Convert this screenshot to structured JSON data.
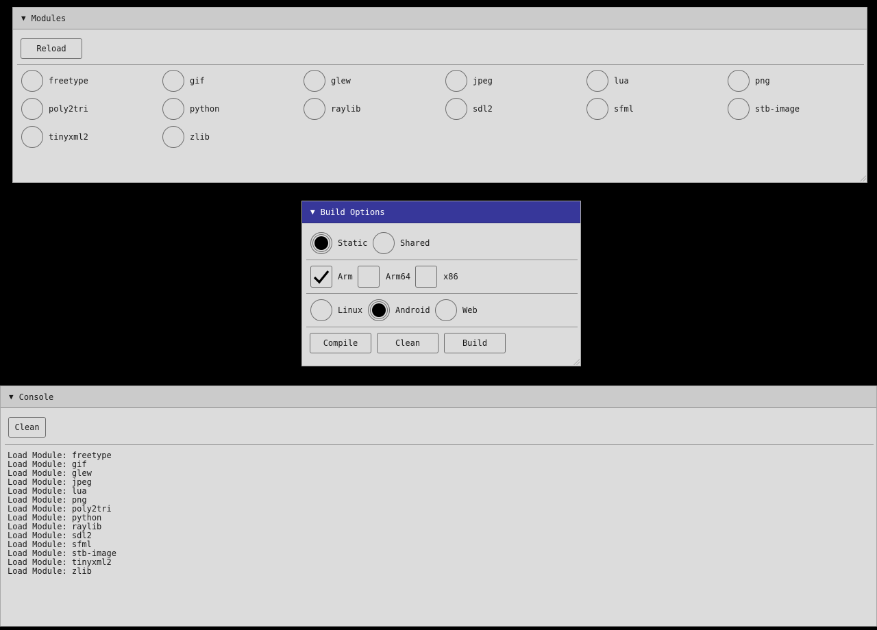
{
  "modules": {
    "title": "Modules",
    "reload_label": "Reload",
    "items": [
      "freetype",
      "gif",
      "glew",
      "jpeg",
      "lua",
      "png",
      "poly2tri",
      "python",
      "raylib",
      "sdl2",
      "sfml",
      "stb-image",
      "tinyxml2",
      "zlib"
    ]
  },
  "build": {
    "title": "Build Options",
    "link": [
      {
        "label": "Static",
        "selected": true
      },
      {
        "label": "Shared",
        "selected": false
      }
    ],
    "arch": [
      {
        "label": "Arm",
        "checked": true
      },
      {
        "label": "Arm64",
        "checked": false
      },
      {
        "label": "x86",
        "checked": false
      }
    ],
    "platform": [
      {
        "label": "Linux",
        "selected": false
      },
      {
        "label": "Android",
        "selected": true
      },
      {
        "label": "Web",
        "selected": false
      }
    ],
    "compile_label": "Compile",
    "clean_label": "Clean",
    "build_label": "Build"
  },
  "console": {
    "title": "Console",
    "clean_label": "Clean",
    "lines": [
      "Load Module: freetype",
      "Load Module: gif",
      "Load Module: glew",
      "Load Module: jpeg",
      "Load Module: lua",
      "Load Module: png",
      "Load Module: poly2tri",
      "Load Module: python",
      "Load Module: raylib",
      "Load Module: sdl2",
      "Load Module: sfml",
      "Load Module: stb-image",
      "Load Module: tinyxml2",
      "Load Module: zlib"
    ]
  }
}
